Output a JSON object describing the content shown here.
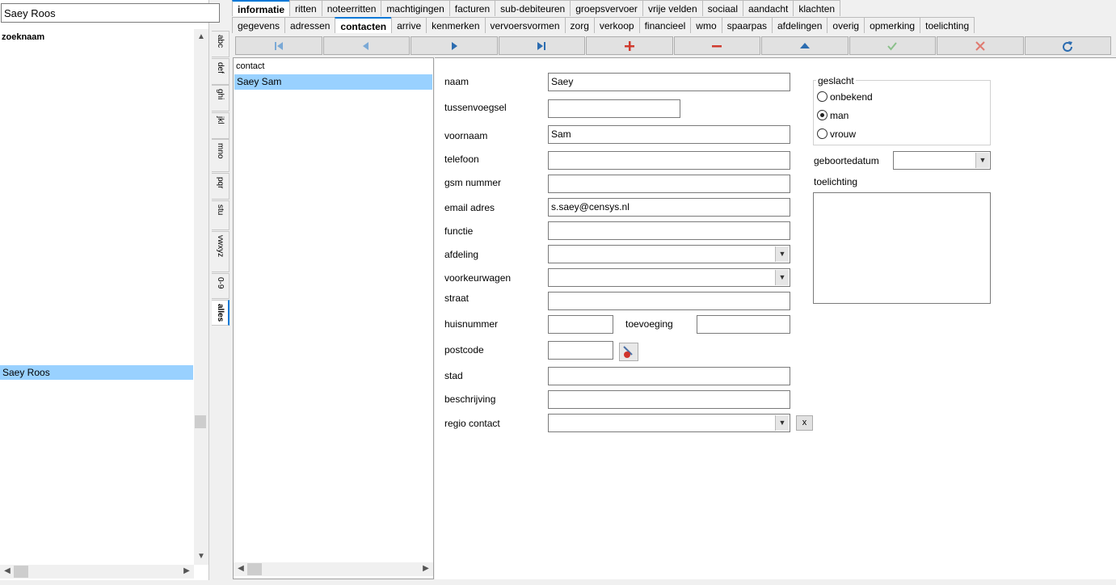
{
  "search": {
    "value": "Saey Roos"
  },
  "list": {
    "header": "zoeknaam",
    "selected_item": "Saey Roos"
  },
  "alphabet": [
    "abc",
    "def",
    "ghi",
    "jkl",
    "mno",
    "pqr",
    "stu",
    "vwxyz",
    "0-9",
    "alles"
  ],
  "alphabet_active": "alles",
  "tabs_top": [
    "informatie",
    "ritten",
    "noteerritten",
    "machtigingen",
    "facturen",
    "sub-debiteuren",
    "groepsvervoer",
    "vrije velden",
    "sociaal",
    "aandacht",
    "klachten"
  ],
  "tabs_top_active": "informatie",
  "tabs_sub": [
    "gegevens",
    "adressen",
    "contacten",
    "arrive",
    "kenmerken",
    "vervoersvormen",
    "zorg",
    "verkoop",
    "financieel",
    "wmo",
    "spaarpas",
    "afdelingen",
    "overig",
    "opmerking",
    "toelichting"
  ],
  "tabs_sub_active": "contacten",
  "toolbar": [
    "first-icon",
    "previous-icon",
    "next-icon",
    "last-icon",
    "add-icon",
    "remove-icon",
    "up-icon",
    "confirm-icon",
    "cancel-icon",
    "refresh-icon"
  ],
  "contacts": {
    "header": "contact",
    "selected": "Saey  Sam"
  },
  "form": {
    "naam": {
      "label": "naam",
      "value": "Saey"
    },
    "tussenvoegsel": {
      "label": "tussenvoegsel",
      "value": ""
    },
    "voornaam": {
      "label": "voornaam",
      "value": "Sam"
    },
    "telefoon": {
      "label": "telefoon",
      "value": ""
    },
    "gsm": {
      "label": "gsm nummer",
      "value": ""
    },
    "email": {
      "label": "email adres",
      "value": "s.saey@censys.nl"
    },
    "functie": {
      "label": "functie",
      "value": ""
    },
    "afdeling": {
      "label": "afdeling",
      "value": ""
    },
    "voorkeurwagen": {
      "label": "voorkeurwagen",
      "value": ""
    },
    "straat": {
      "label": "straat",
      "value": ""
    },
    "huisnummer": {
      "label": "huisnummer",
      "value": ""
    },
    "toevoeging": {
      "label": "toevoeging",
      "value": ""
    },
    "postcode": {
      "label": "postcode",
      "value": ""
    },
    "stad": {
      "label": "stad",
      "value": ""
    },
    "beschrijving": {
      "label": "beschrijving",
      "value": ""
    },
    "regio": {
      "label": "regio contact",
      "value": "",
      "clear": "x"
    },
    "geslacht": {
      "label": "geslacht",
      "options": [
        "onbekend",
        "man",
        "vrouw"
      ],
      "selected": "man"
    },
    "geboortedatum": {
      "label": "geboortedatum",
      "value": ""
    },
    "toelichting": {
      "label": "toelichting",
      "value": ""
    }
  },
  "colors": {
    "selection": "#99d1ff",
    "accent": "#0078d7"
  }
}
